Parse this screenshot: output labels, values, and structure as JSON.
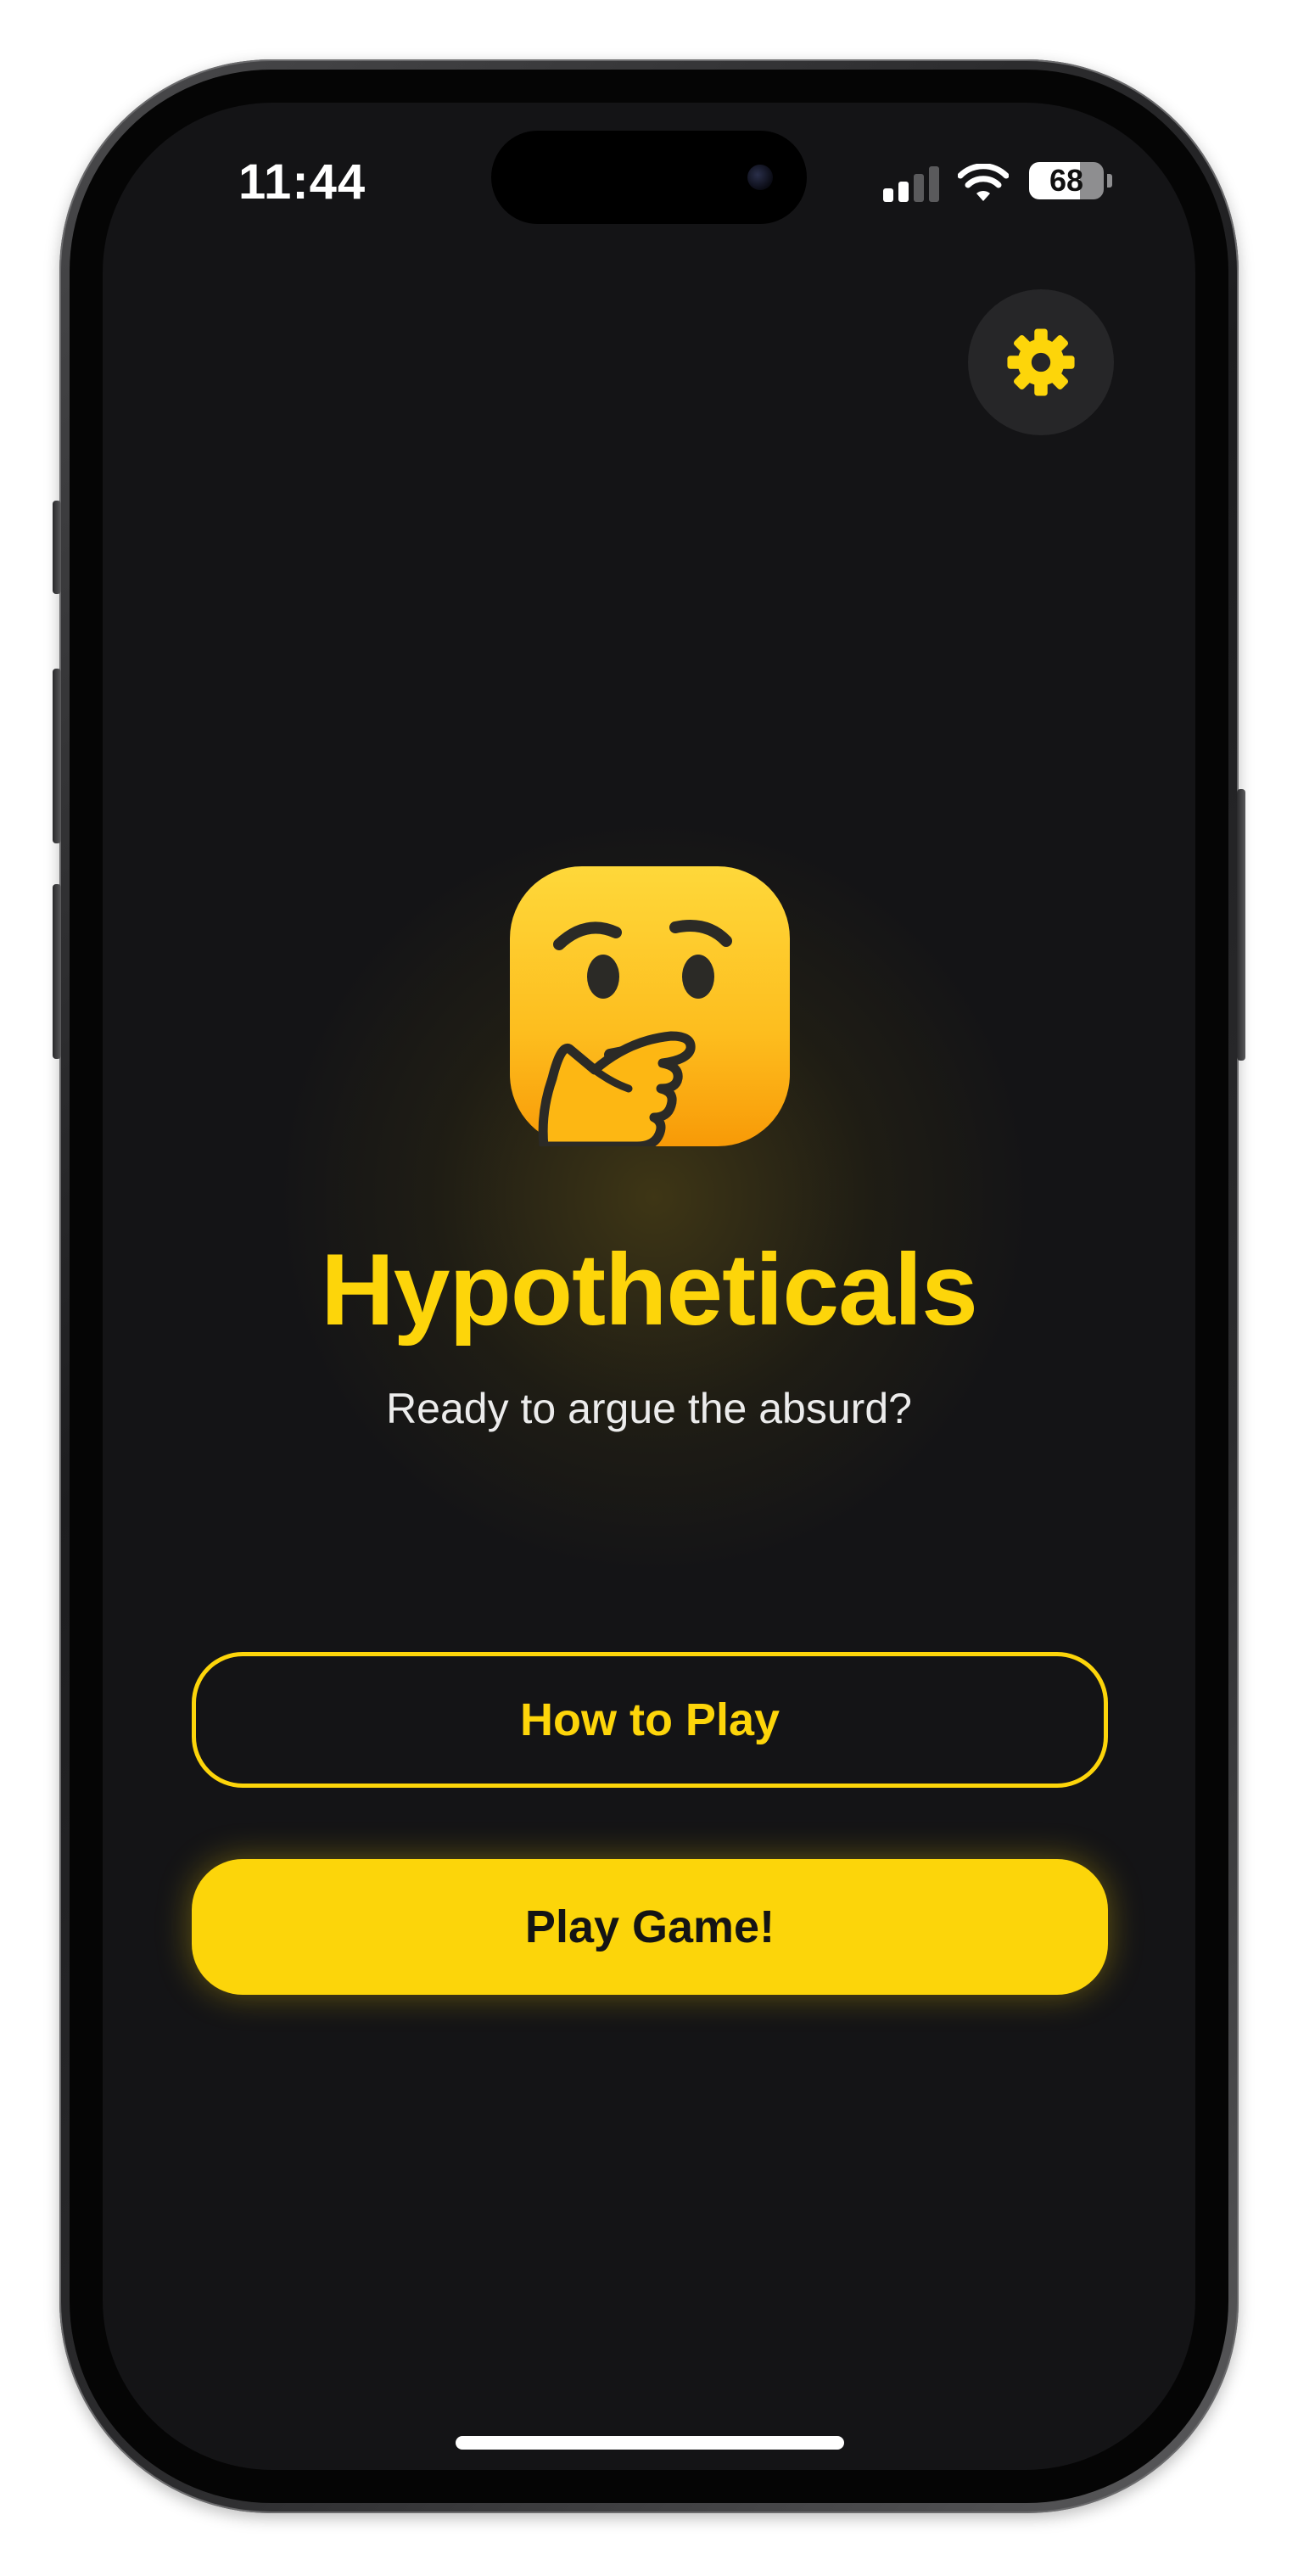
{
  "status_bar": {
    "time": "11:44",
    "battery_level": "68",
    "battery_percent": 68,
    "signal_bars_active": 2,
    "signal_bars_total": 4,
    "icons": [
      "cellular-signal-icon",
      "wifi-icon",
      "battery-icon"
    ]
  },
  "header": {
    "settings_icon": "gear-icon"
  },
  "hero": {
    "emoji": "thinking-face-icon",
    "title": "Hypotheticals",
    "subtitle": "Ready to argue the absurd?"
  },
  "actions": {
    "how_to_play": "How to Play",
    "play_game": "Play Game!"
  },
  "colors": {
    "accent": "#fdd50a",
    "background": "#141416",
    "settings_bg": "#262628",
    "text_primary": "#ececec",
    "button_text_dark": "#141414"
  }
}
